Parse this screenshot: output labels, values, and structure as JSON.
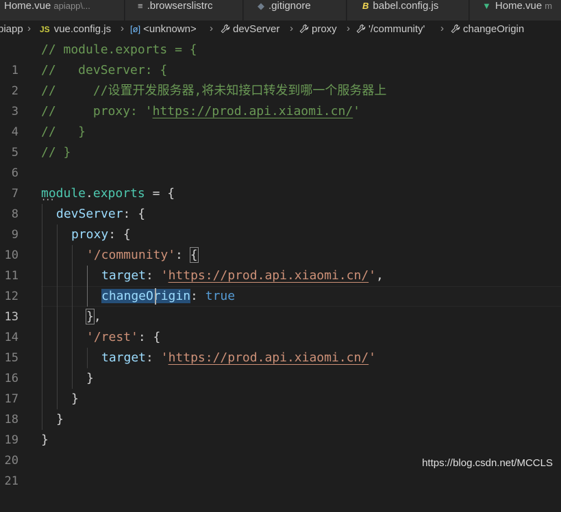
{
  "tabs": [
    {
      "label": "Home.vue",
      "sub": "apiapp\\...",
      "icon": "vue-icon"
    },
    {
      "label": ".browserslistrc",
      "sub": "",
      "icon": "lines-icon"
    },
    {
      "label": ".gitignore",
      "sub": "",
      "icon": "git-icon"
    },
    {
      "label": "babel.config.js",
      "sub": "",
      "icon": "babel-icon"
    },
    {
      "label": "Home.vue",
      "sub": "m",
      "icon": "vue-icon"
    }
  ],
  "tab_icons": {
    "lines": "≡",
    "git": "◆",
    "babel": "B",
    "vue": "▼"
  },
  "breadcrumb": {
    "root": "piapp",
    "file_badge": "JS",
    "file": "vue.config.js",
    "obj_badge": "[ø]",
    "unknown": "<unknown>",
    "dev_server": "devServer",
    "proxy": "proxy",
    "community": "'/community'",
    "change_origin": "changeOrigin"
  },
  "editor": {
    "current_line": 13,
    "line_numbers": [
      "1",
      "2",
      "3",
      "4",
      "5",
      "6",
      "7",
      "8",
      "9",
      "10",
      "11",
      "12",
      "13",
      "14",
      "15",
      "16",
      "17",
      "18",
      "19",
      "20",
      "21"
    ],
    "code": {
      "l1": "// module.exports = {",
      "l2": "//   devServer: {",
      "l3": "//     //设置开发服务器,将未知接口转发到哪一个服务器上",
      "l4_pre": "//     proxy: '",
      "l4_url": "https://prod.api.xiaomi.cn/",
      "l4_post": "'",
      "l5": "//   }",
      "l6": "// }",
      "l8_var": "module",
      "l8_dot": ".",
      "l8_prop": "exports",
      "l8_rest": " = {",
      "l9_prop": "devServer",
      "l9_rest": ": {",
      "l10_prop": "proxy",
      "l10_rest": ": {",
      "l11_str": "'/community'",
      "l11_colon": ": ",
      "l11_brace": "{",
      "l12_prop": "target",
      "l12_colon": ": ",
      "l12_q1": "'",
      "l12_url": "https://prod.api.xiaomi.cn/",
      "l12_q2": "'",
      "l12_comma": ",",
      "l13_prop_a": "changeO",
      "l13_prop_b": "rigin",
      "l13_colon": ": ",
      "l13_val": "true",
      "l14_brace": "}",
      "l14_comma": ",",
      "l15_str": "'/rest'",
      "l15_rest": ": {",
      "l16_prop": "target",
      "l16_colon": ": ",
      "l16_q1": "'",
      "l16_url": "https://prod.api.xiaomi.cn/",
      "l16_q2": "'",
      "l17": "}",
      "l18": "}",
      "l19": "}",
      "l20": "}"
    }
  },
  "watermark": "https://blog.csdn.net/MCCLS"
}
